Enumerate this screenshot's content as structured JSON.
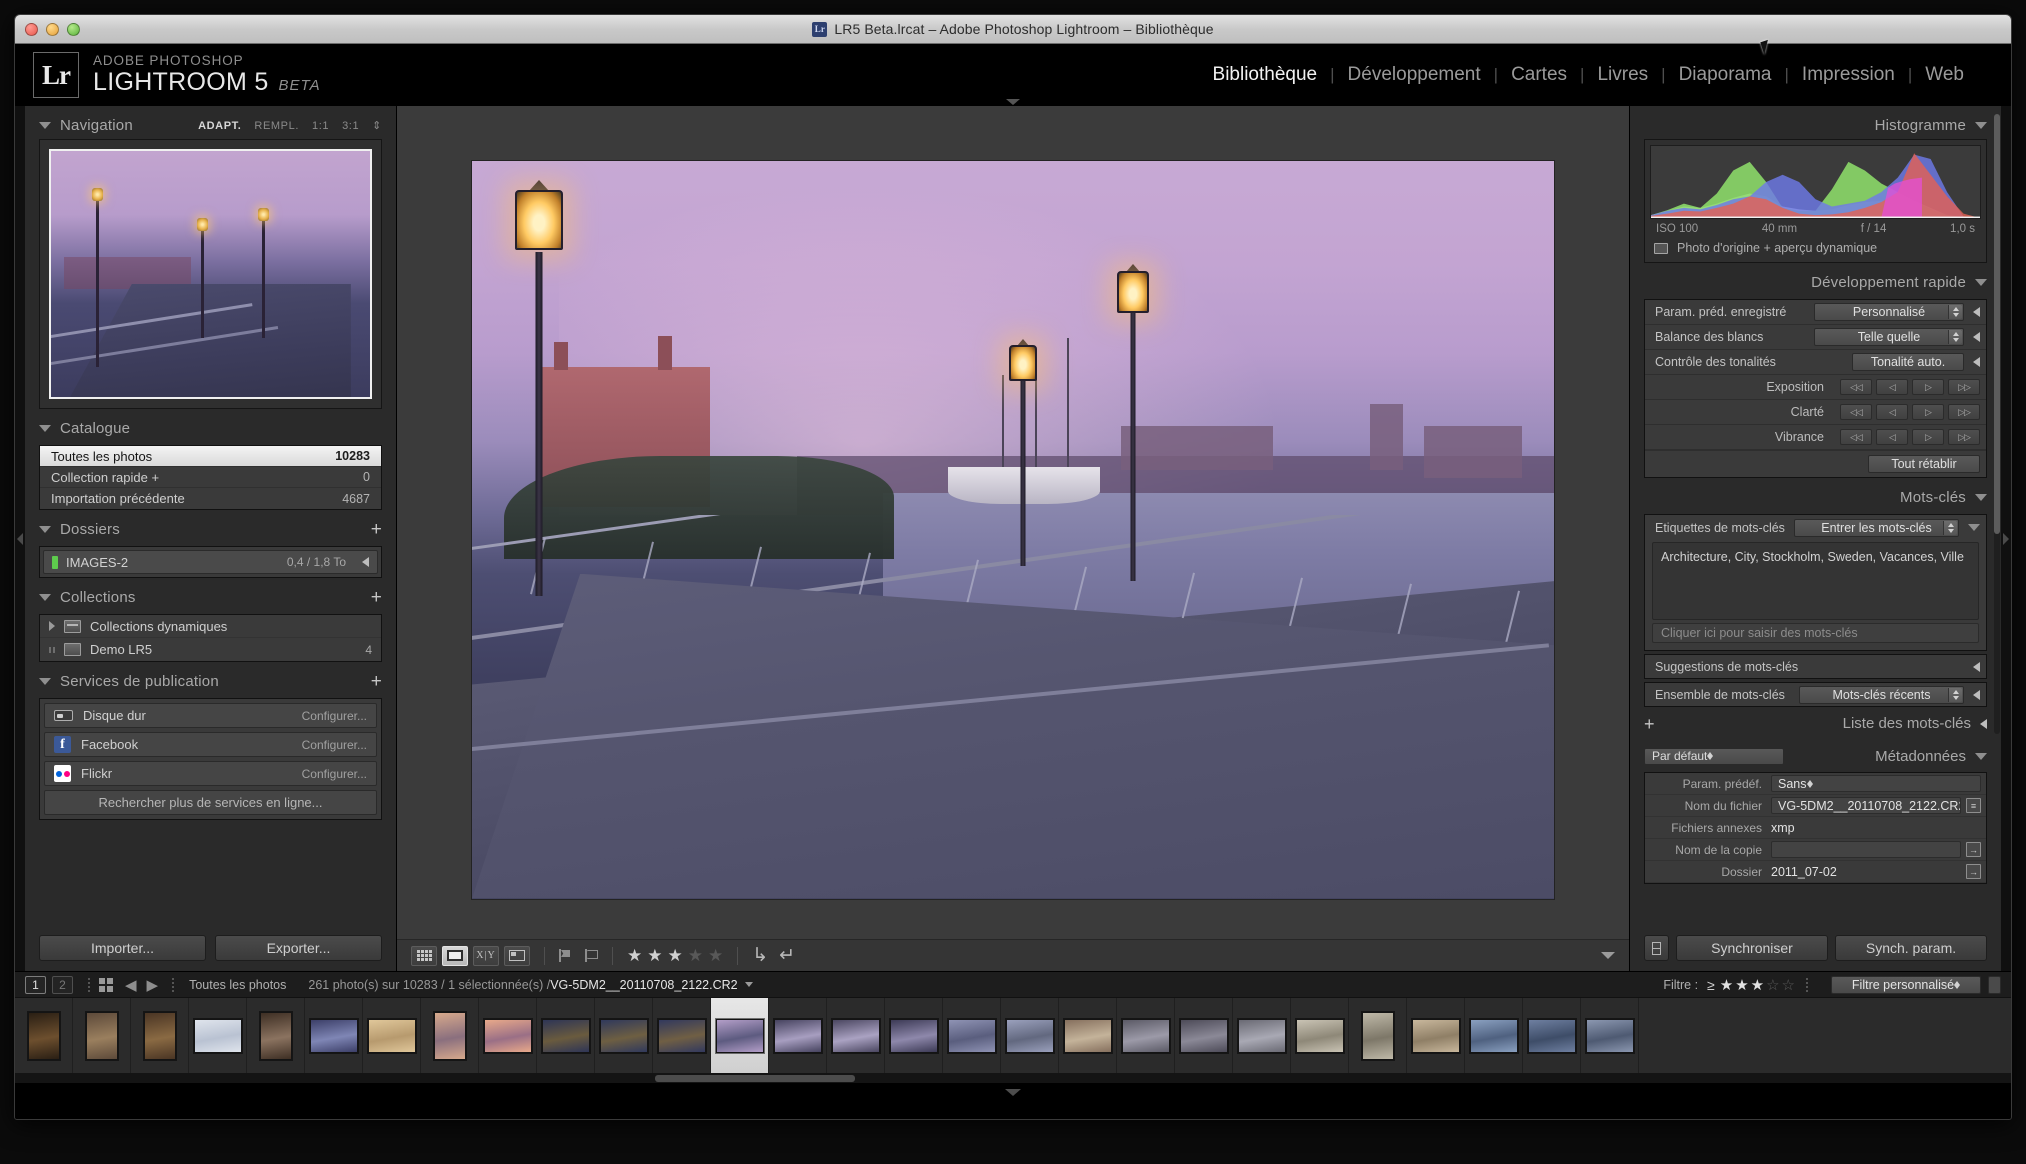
{
  "window": {
    "title": "LR5 Beta.lrcat – Adobe Photoshop Lightroom – Bibliothèque",
    "app_badge": "Lr"
  },
  "identity": {
    "brand_top": "ADOBE PHOTOSHOP",
    "brand_main": "LIGHTROOM 5",
    "brand_beta": "BETA"
  },
  "modules": [
    {
      "label": "Bibliothèque",
      "active": true
    },
    {
      "label": "Développement",
      "active": false
    },
    {
      "label": "Cartes",
      "active": false
    },
    {
      "label": "Livres",
      "active": false
    },
    {
      "label": "Diaporama",
      "active": false
    },
    {
      "label": "Impression",
      "active": false
    },
    {
      "label": "Web",
      "active": false
    }
  ],
  "left_panel": {
    "navigation": {
      "title": "Navigation",
      "zoom_levels": [
        "ADAPT.",
        "REMPL.",
        "1:1",
        "3:1"
      ],
      "active_zoom": "ADAPT."
    },
    "catalogue": {
      "title": "Catalogue",
      "rows": [
        {
          "label": "Toutes les photos",
          "count": "10283",
          "selected": true
        },
        {
          "label": "Collection rapide +",
          "count": "0",
          "selected": false
        },
        {
          "label": "Importation précédente",
          "count": "4687",
          "selected": false
        }
      ]
    },
    "dossiers": {
      "title": "Dossiers",
      "volume": {
        "label": "IMAGES-2",
        "size": "0,4 / 1,8 To"
      }
    },
    "collections": {
      "title": "Collections",
      "rows": [
        {
          "label": "Collections dynamiques",
          "count": "",
          "expandable": true
        },
        {
          "label": "Demo LR5",
          "count": "4",
          "expandable": false
        }
      ]
    },
    "publication": {
      "title": "Services de publication",
      "services": [
        {
          "label": "Disque dur",
          "action": "Configurer...",
          "icon": "hard-drive-icon"
        },
        {
          "label": "Facebook",
          "action": "Configurer...",
          "icon": "facebook-icon"
        },
        {
          "label": "Flickr",
          "action": "Configurer...",
          "icon": "flickr-icon"
        }
      ],
      "more_label": "Rechercher plus de services en ligne..."
    },
    "buttons": {
      "import": "Importer...",
      "export": "Exporter..."
    }
  },
  "right_panel": {
    "histogram": {
      "title": "Histogramme",
      "iso": "ISO 100",
      "focal": "40 mm",
      "aperture": "f / 14",
      "shutter": "1,0 s",
      "original_label": "Photo d'origine + aperçu dynamique"
    },
    "quick_develop": {
      "title": "Développement rapide",
      "rows": [
        {
          "label": "Param. préd. enregistré",
          "value": "Personnalisé",
          "kind": "select"
        },
        {
          "label": "Balance des blancs",
          "value": "Telle quelle",
          "kind": "select"
        },
        {
          "label": "Contrôle des tonalités",
          "value": "Tonalité auto.",
          "kind": "button"
        },
        {
          "label": "Exposition",
          "kind": "nudge"
        },
        {
          "label": "Clarté",
          "kind": "nudge"
        },
        {
          "label": "Vibrance",
          "kind": "nudge"
        }
      ],
      "reset_label": "Tout rétablir"
    },
    "keywords": {
      "title": "Mots-clés",
      "tags_label": "Etiquettes de mots-clés",
      "tags_mode": "Entrer les mots-clés",
      "tags_value": "Architecture, City, Stockholm, Sweden, Vacances, Ville",
      "click_placeholder": "Cliquer ici pour saisir des mots-clés",
      "suggestions_label": "Suggestions de mots-clés",
      "set_label": "Ensemble de mots-clés",
      "set_value": "Mots-clés récents",
      "list_title": "Liste des mots-clés"
    },
    "metadata": {
      "title": "Métadonnées",
      "view_preset": "Par défaut",
      "rows": [
        {
          "key": "Param. prédéf.",
          "value": "Sans",
          "kind": "select"
        },
        {
          "key": "Nom du fichier",
          "value": "VG-5DM2__20110708_2122.CR2",
          "kind": "field-icon"
        },
        {
          "key": "Fichiers annexes",
          "value": "xmp",
          "kind": "text"
        },
        {
          "key": "Nom de la copie",
          "value": "",
          "kind": "field-arrow"
        },
        {
          "key": "Dossier",
          "value": "2011_07-02",
          "kind": "text-arrow"
        }
      ]
    },
    "sync": {
      "synchronise": "Synchroniser",
      "sync_params": "Synch. param."
    }
  },
  "toolbar": {
    "view_grid": "grid-view-icon",
    "view_loupe": "loupe-view-icon",
    "view_compare": "compare-view-icon",
    "view_survey": "survey-view-icon",
    "flag_pick": "flag-pick-icon",
    "flag_reject": "flag-reject-icon",
    "rating_value": 3,
    "rating_max": 5,
    "rotate_right": "rotate-right-icon",
    "rotate_left": "rotate-left-icon"
  },
  "filmstrip": {
    "screen_1": "1",
    "screen_2": "2",
    "source_label": "Toutes les photos",
    "counts": "261 photo(s) sur 10283 / 1 sélectionnée(s) /",
    "filename": "VG-5DM2__20110708_2122.CR2",
    "filter_label": "Filtre :",
    "filter_ge": "≥",
    "filter_stars": 3,
    "filter_preset": "Filtre personnalisé",
    "selected_index": 12,
    "thumb_count": 28
  },
  "chart_data": {
    "type": "area",
    "title": "Histogramme",
    "xlabel": "",
    "ylabel": "",
    "channels": [
      "red",
      "green",
      "blue",
      "luminance"
    ],
    "x": [
      0,
      5,
      10,
      15,
      20,
      25,
      30,
      35,
      40,
      45,
      50,
      55,
      60,
      65,
      70,
      75,
      80,
      85,
      90,
      95,
      100
    ],
    "series": [
      {
        "name": "red",
        "values": [
          3,
          6,
          10,
          9,
          14,
          20,
          30,
          26,
          14,
          6,
          4,
          5,
          8,
          14,
          22,
          36,
          92,
          60,
          30,
          6,
          1
        ]
      },
      {
        "name": "green",
        "values": [
          4,
          9,
          16,
          12,
          26,
          50,
          60,
          40,
          12,
          7,
          6,
          9,
          30,
          56,
          50,
          38,
          30,
          20,
          10,
          3,
          1
        ]
      },
      {
        "name": "blue",
        "values": [
          4,
          8,
          12,
          10,
          16,
          22,
          26,
          24,
          40,
          48,
          40,
          22,
          14,
          16,
          20,
          30,
          44,
          72,
          66,
          28,
          2
        ]
      },
      {
        "name": "luminance",
        "values": [
          6,
          12,
          18,
          16,
          22,
          30,
          34,
          30,
          18,
          14,
          12,
          14,
          20,
          26,
          28,
          30,
          34,
          30,
          18,
          6,
          1
        ]
      }
    ]
  }
}
